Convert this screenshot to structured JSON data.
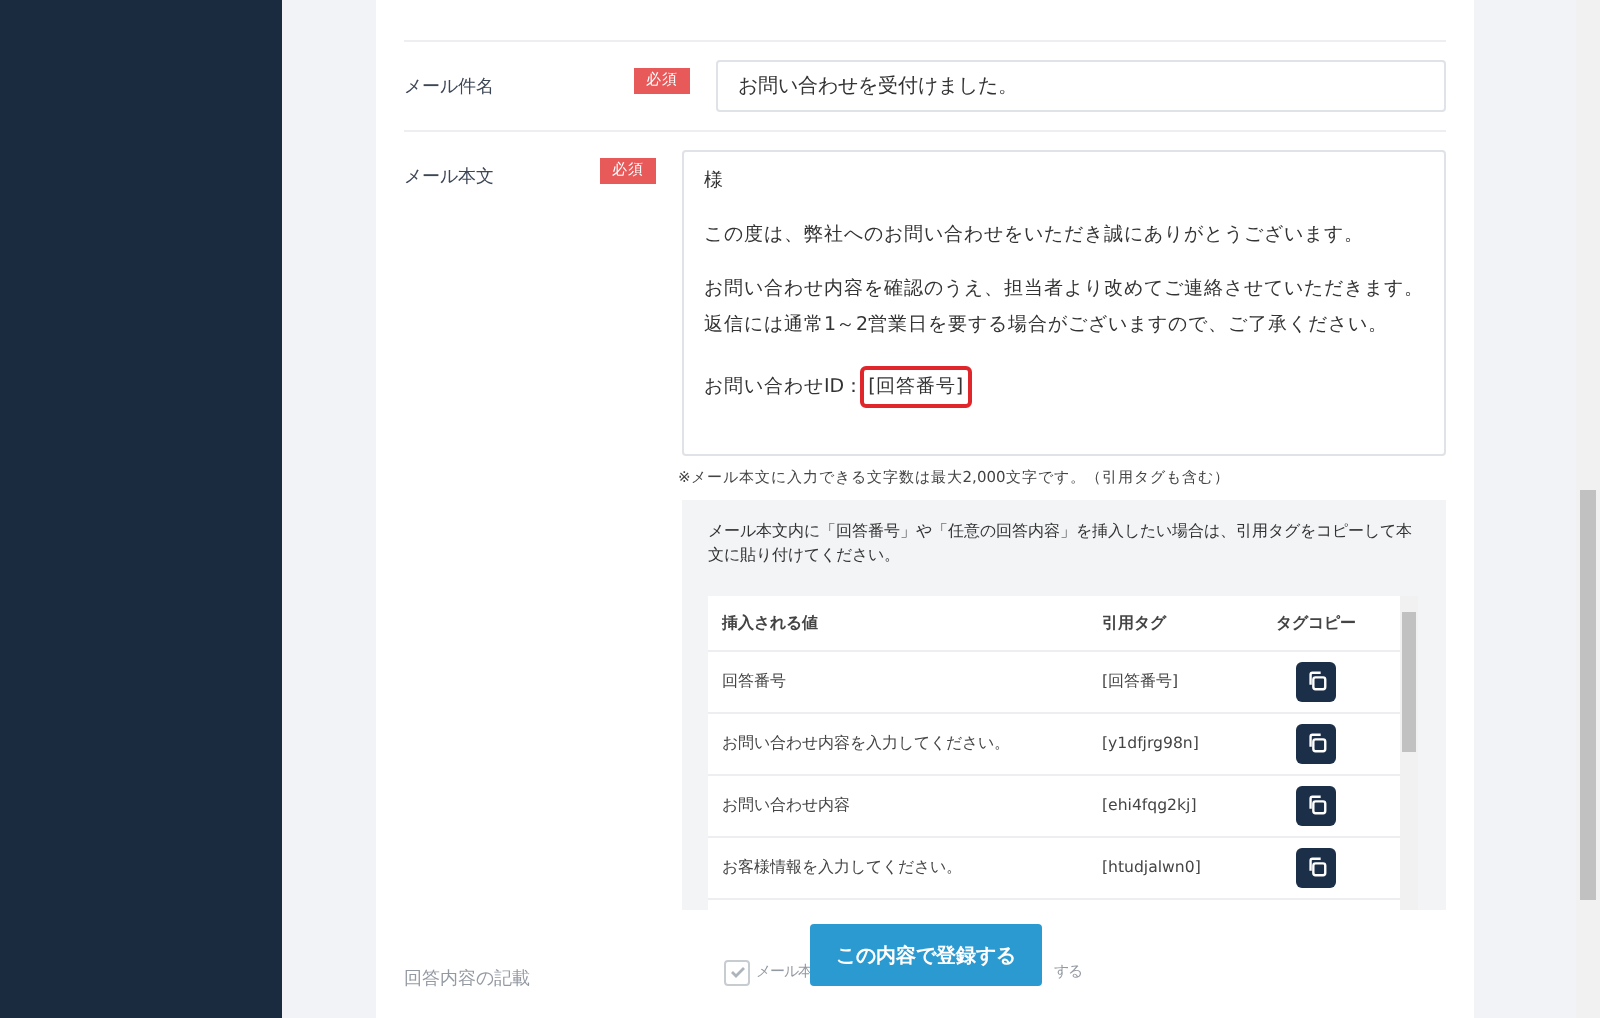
{
  "form": {
    "rows": [
      {
        "kind": "text",
        "label": "メール件名",
        "badge": "必須",
        "value": "お問い合わせを受付けました。"
      },
      {
        "kind": "body",
        "label": "メール本文",
        "badge": "必須",
        "paragraphs": [
          [
            "様"
          ],
          [
            "この度は、弊社へのお問い合わせをいただき誠にありがとうございます。"
          ],
          [
            "お問い合わせ内容を確認のうえ、担当者より改めてご連絡させていただきます。",
            "返信には通常1～2営業日を要する場合がございますので、ご了承ください。"
          ]
        ],
        "id_line": {
          "label": "お問い合わせID：",
          "tag": "[回答番号]",
          "highlighted": true
        },
        "note": "※メール本文に入力できる文字数は最大2,000文字です。（引用タグも含む）"
      }
    ]
  },
  "tag_panel": {
    "intro": "メール本文内に「回答番号」や「任意の回答内容」を挿入したい場合は、引用タグをコピーして本文に貼り付けてください。",
    "columns": [
      "挿入される値",
      "引用タグ",
      "タグコピー"
    ],
    "rows": [
      {
        "value": "回答番号",
        "tag": "[回答番号]"
      },
      {
        "value": "お問い合わせ内容を入力してください。",
        "tag": "[y1dfjrg98n]"
      },
      {
        "value": "お問い合わせ内容",
        "tag": "[ehi4fqg2kj]"
      },
      {
        "value": "お客様情報を入力してください。",
        "tag": "[htudjalwn0]"
      }
    ]
  },
  "faded_row": {
    "label": "回答内容の記載",
    "checked": true,
    "text_before": "メール本",
    "text_after": "する"
  },
  "submit_button": "この内容で登録する"
}
